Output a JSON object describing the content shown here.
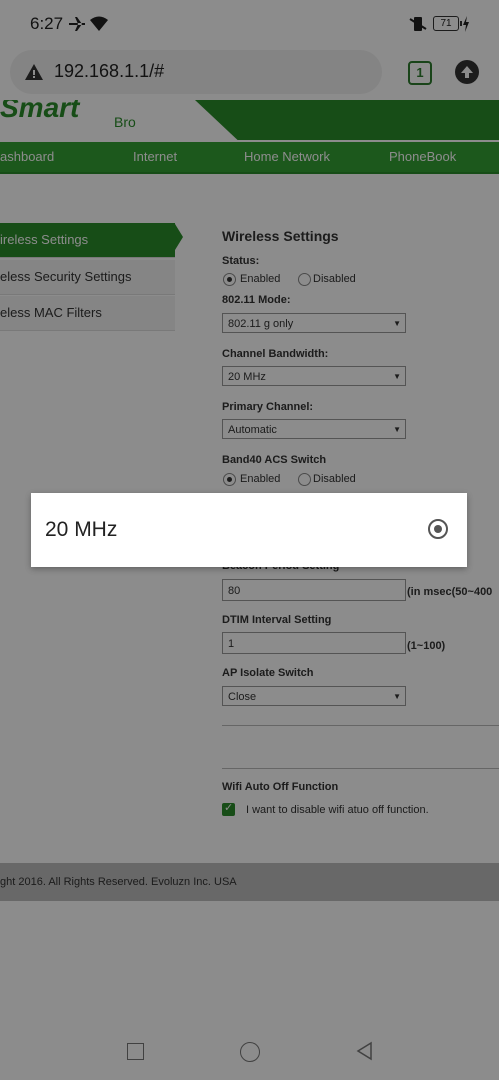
{
  "status_bar": {
    "time": "6:27",
    "battery": "71"
  },
  "address_bar": {
    "url": "192.168.1.1/#",
    "tab_count": "1"
  },
  "banner": {
    "logo_text": "Smart",
    "logo_sub": "Bro"
  },
  "nav": [
    "ashboard",
    "Internet",
    "Home Network",
    "PhoneBook"
  ],
  "sidebar": [
    {
      "label": "ireless Settings"
    },
    {
      "label": "eless Security Settings"
    },
    {
      "label": "eless MAC Filters"
    }
  ],
  "form": {
    "title": "Wireless Settings",
    "status_label": "Status:",
    "enabled": "Enabled",
    "disabled": "Disabled",
    "mode_label": "802.11 Mode:",
    "mode_value": "802.11 g only",
    "bandwidth_label": "Channel Bandwidth:",
    "bandwidth_value": "20 MHz",
    "primary_label": "Primary Channel:",
    "primary_value": "Automatic",
    "band40_label": "Band40 ACS Switch",
    "band40_enabled": "Enabled",
    "band40_disabled": "Disabled",
    "beacon_label": "Beacon Period Setting",
    "beacon_value": "80",
    "beacon_hint": "(in msec(50~400",
    "dtim_label": "DTIM Interval Setting",
    "dtim_value": "1",
    "dtim_hint": "(1~100)",
    "ap_label": "AP Isolate Switch",
    "ap_value": "Close",
    "wifi_label": "Wifi Auto Off Function",
    "wifi_checkbox": "I want to disable wifi atuo off function."
  },
  "footer": {
    "text": "ght 2016. All Rights Reserved. Evoluzn Inc. USA"
  },
  "dialog": {
    "option": "20 MHz"
  }
}
